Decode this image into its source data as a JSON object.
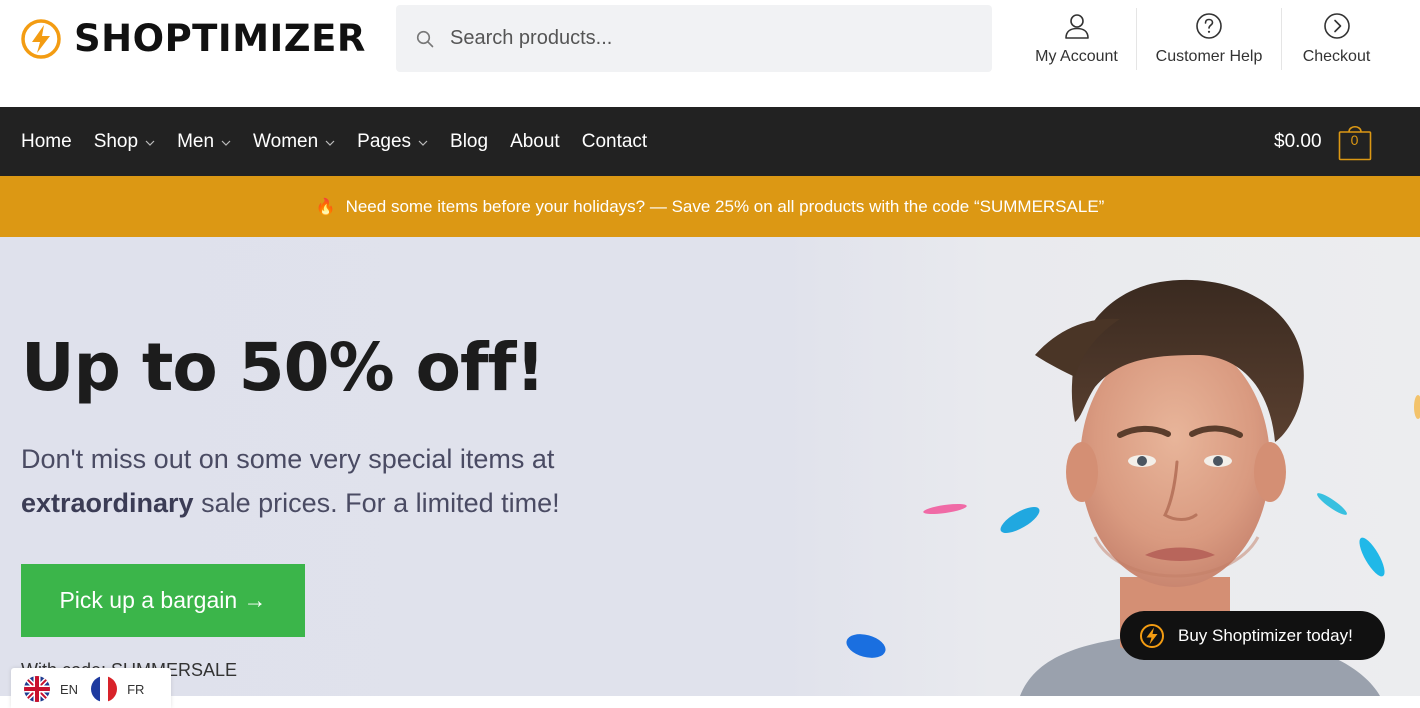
{
  "brand": {
    "name": "SHOPTIMIZER",
    "accent": "#dc9814",
    "dark": "#222222",
    "green": "#3bb54a"
  },
  "search": {
    "placeholder": "Search products..."
  },
  "header_links": [
    {
      "label": "My Account",
      "icon": "user-icon"
    },
    {
      "label": "Customer Help",
      "icon": "question-circle-icon"
    },
    {
      "label": "Checkout",
      "icon": "chevron-right-circle-icon"
    }
  ],
  "nav": {
    "items": [
      {
        "label": "Home",
        "dropdown": false
      },
      {
        "label": "Shop",
        "dropdown": true
      },
      {
        "label": "Men",
        "dropdown": true
      },
      {
        "label": "Women",
        "dropdown": true
      },
      {
        "label": "Pages",
        "dropdown": true
      },
      {
        "label": "Blog",
        "dropdown": false
      },
      {
        "label": "About",
        "dropdown": false
      },
      {
        "label": "Contact",
        "dropdown": false
      }
    ],
    "cart_total": "$0.00",
    "cart_count": "0"
  },
  "promo": {
    "icon": "fire-icon",
    "text": "Need some items before your holidays? — Save 25% on all products with the code “SUMMERSALE”"
  },
  "hero": {
    "title": "Up to 50% off!",
    "subtitle_line1": "Don't miss out on some very special items at",
    "subtitle_bold": "extraordinary",
    "subtitle_rest": " sale prices. For a limited time!",
    "cta_label": "Pick up a bargain →",
    "code_note": "With code: SUMMERSALE"
  },
  "badge": {
    "label": "Buy Shoptimizer today!"
  },
  "languages": [
    {
      "code": "EN",
      "icon": "uk-flag-icon"
    },
    {
      "code": "FR",
      "icon": "france-flag-icon"
    }
  ]
}
